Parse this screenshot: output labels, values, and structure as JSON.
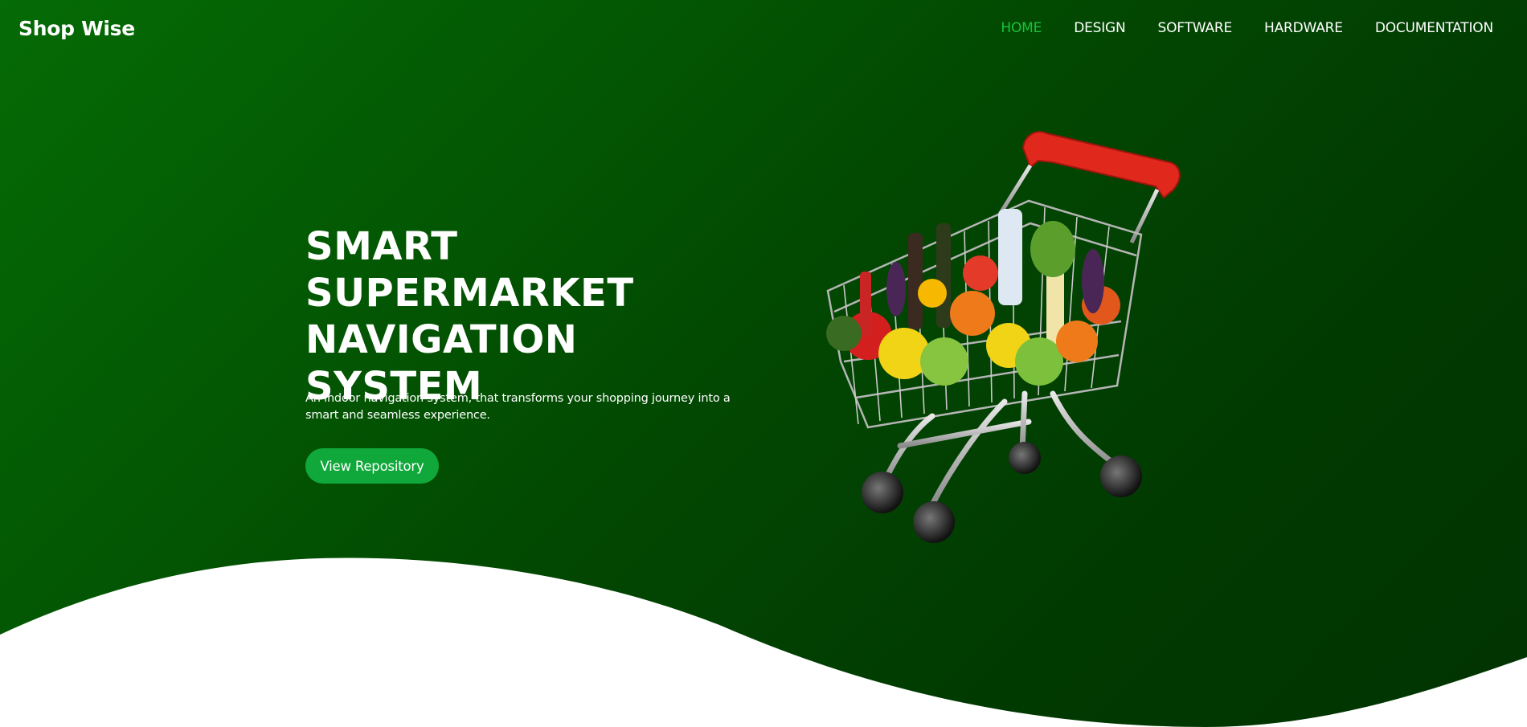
{
  "brand": "Shop Wise",
  "nav": {
    "items": [
      {
        "label": "HOME",
        "active": true
      },
      {
        "label": "DESIGN",
        "active": false
      },
      {
        "label": "SOFTWARE",
        "active": false
      },
      {
        "label": "HARDWARE",
        "active": false
      },
      {
        "label": "DOCUMENTATION",
        "active": false
      }
    ]
  },
  "hero": {
    "title_lines": [
      "SMART",
      "SUPERMARKET",
      "NAVIGATION SYSTEM"
    ],
    "subtitle": "An indoor navigation system, that transforms your shopping journey into a smart and seamless experience.",
    "cta_label": "View Repository",
    "image": "shopping-cart-with-groceries"
  },
  "colors": {
    "background_gradient_start": "#056b05",
    "background_gradient_end": "#013301",
    "accent_green": "#19c23a",
    "button_green": "#10a83a",
    "text_white": "#ffffff"
  }
}
